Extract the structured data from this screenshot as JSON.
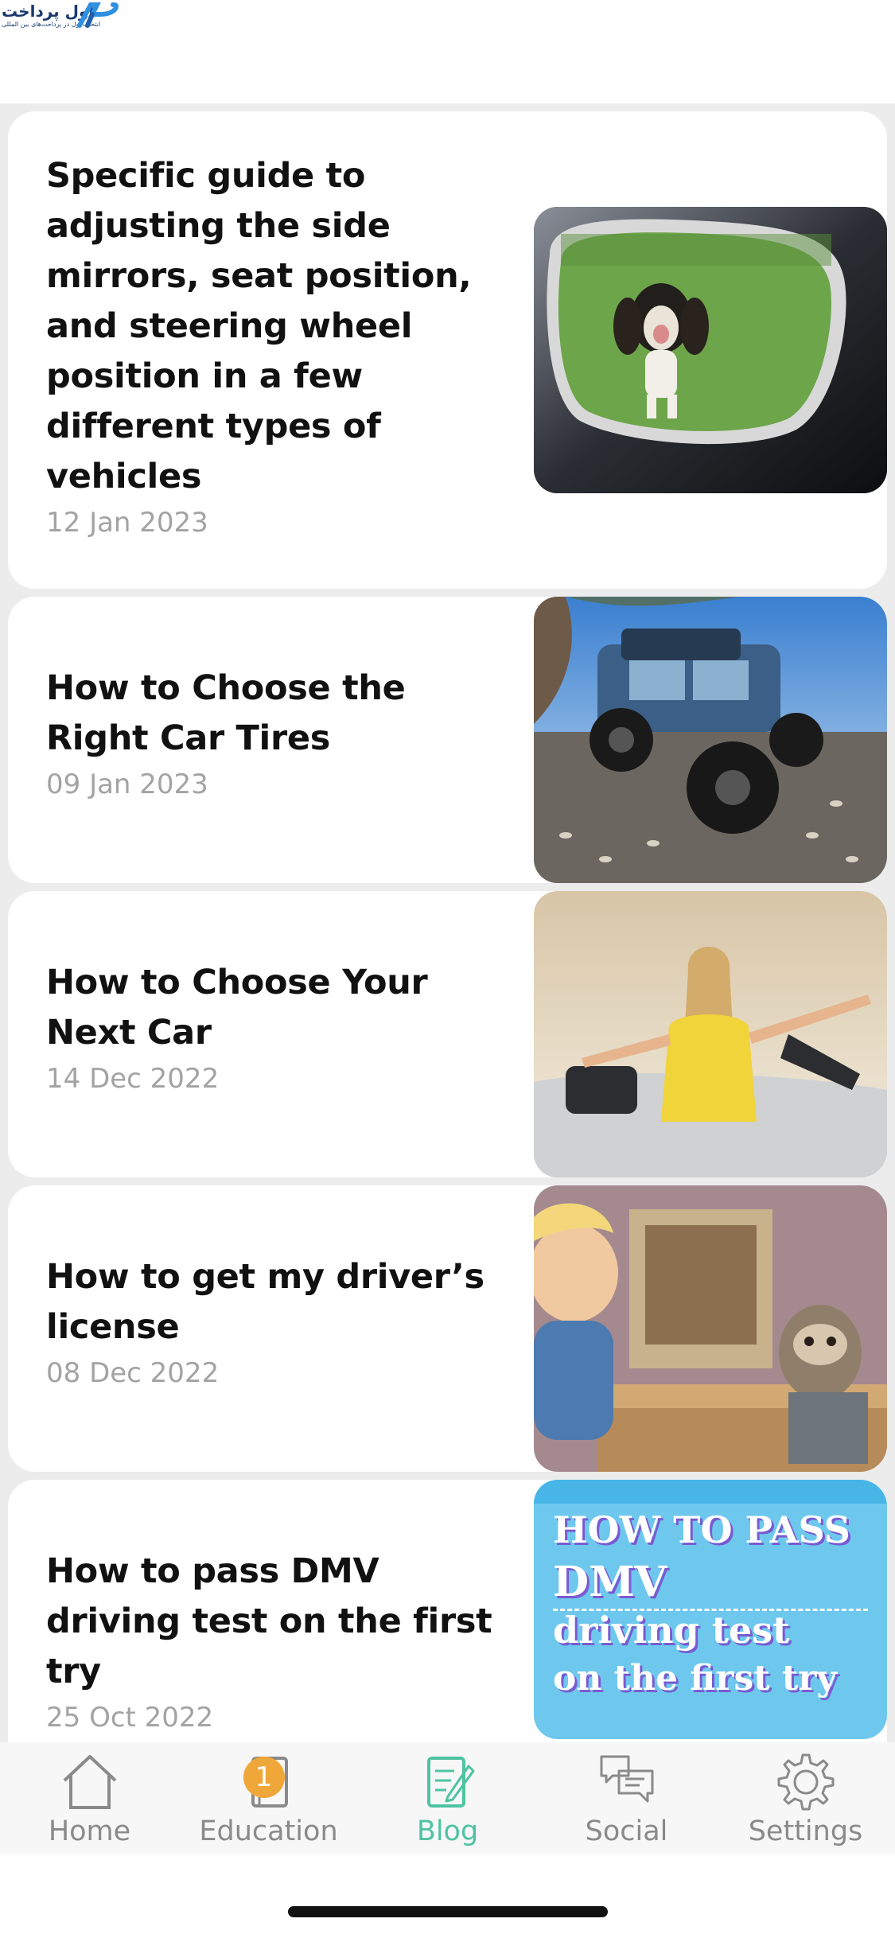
{
  "header": {
    "logo_name": "اول پرداخت",
    "logo_tagline": "انتخاب اول در پرداخت‌های بین المللی"
  },
  "posts": [
    {
      "title": "Specific guide to adjusting the side mirrors, seat position, and steering wheel position in a few different types of vehicles",
      "date": "12 Jan 2023"
    },
    {
      "title": "How to Choose the Right Car Tires",
      "date": "09 Jan 2023"
    },
    {
      "title": "How to Choose Your Next Car",
      "date": "14 Dec 2022"
    },
    {
      "title": "How to get my driver’s license",
      "date": "08 Dec 2022"
    },
    {
      "title": "How to pass DMV driving test on the first try",
      "date": "25 Oct 2022",
      "thumb_lines": [
        "HOW TO PASS",
        "DMV",
        "driving test",
        "on the first try"
      ]
    }
  ],
  "tabs": [
    {
      "label": "Home",
      "icon": "home-icon"
    },
    {
      "label": "Education",
      "icon": "book-icon",
      "badge": "1"
    },
    {
      "label": "Blog",
      "icon": "blog-edit-icon",
      "active": true
    },
    {
      "label": "Social",
      "icon": "chat-bubbles-icon"
    },
    {
      "label": "Settings",
      "icon": "gear-icon"
    }
  ],
  "colors": {
    "accent": "#4fc3a1",
    "badge": "#f0a73a",
    "date": "#a3a3a3"
  }
}
